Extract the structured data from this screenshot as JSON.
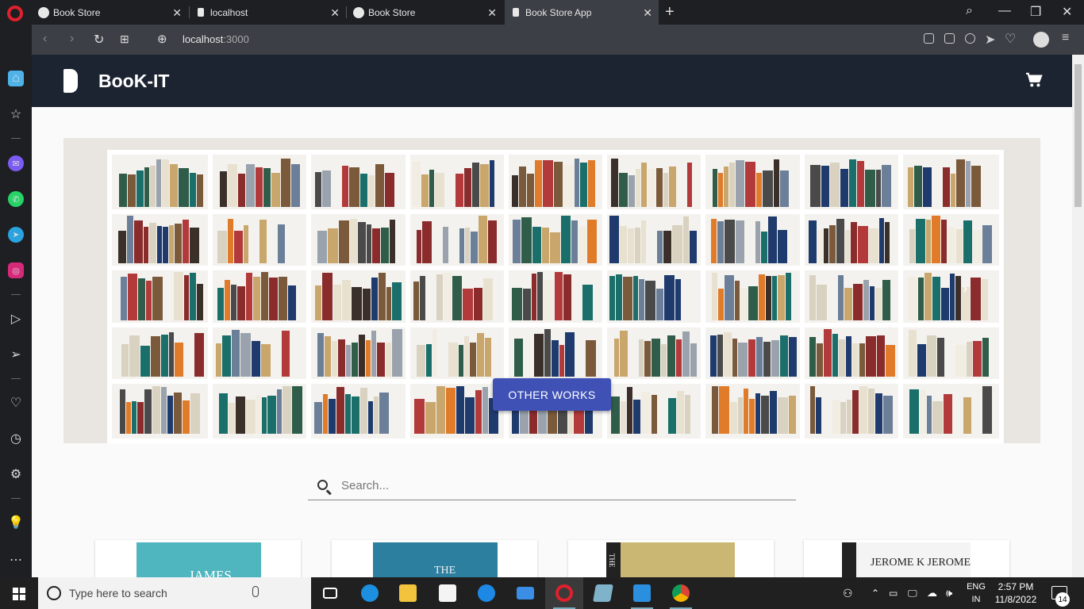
{
  "browser": {
    "tabs": [
      {
        "title": "Book Store",
        "favicon": "globe-icon"
      },
      {
        "title": "localhost",
        "favicon": "document-icon"
      },
      {
        "title": "Book Store",
        "favicon": "globe-icon"
      },
      {
        "title": "Book Store App",
        "favicon": "document-icon",
        "active": true
      }
    ],
    "url_host": "localhost",
    "url_port": ":3000"
  },
  "app": {
    "brand": "BooK-IT",
    "accent": "#3f51b5",
    "appbar_color": "#1c2331",
    "hero": {
      "button_label": "OTHER WORKS",
      "next_icon": "chevron-right-icon"
    },
    "search": {
      "placeholder": "Search..."
    },
    "books": [
      {
        "cover_text": "JAMES",
        "cover_color": "#4fb5be"
      },
      {
        "cover_text": "THE",
        "cover_color": "#2d7fa0"
      },
      {
        "cover_text": "THE",
        "cover_color": "#cbb774"
      },
      {
        "cover_text": "JEROME K JEROME",
        "cover_color": "#f4f4f4"
      }
    ]
  },
  "taskbar": {
    "search_placeholder": "Type here to search",
    "lang_line1": "ENG",
    "lang_line2": "IN",
    "time": "2:57 PM",
    "date": "11/8/2022",
    "notifications": "14"
  }
}
